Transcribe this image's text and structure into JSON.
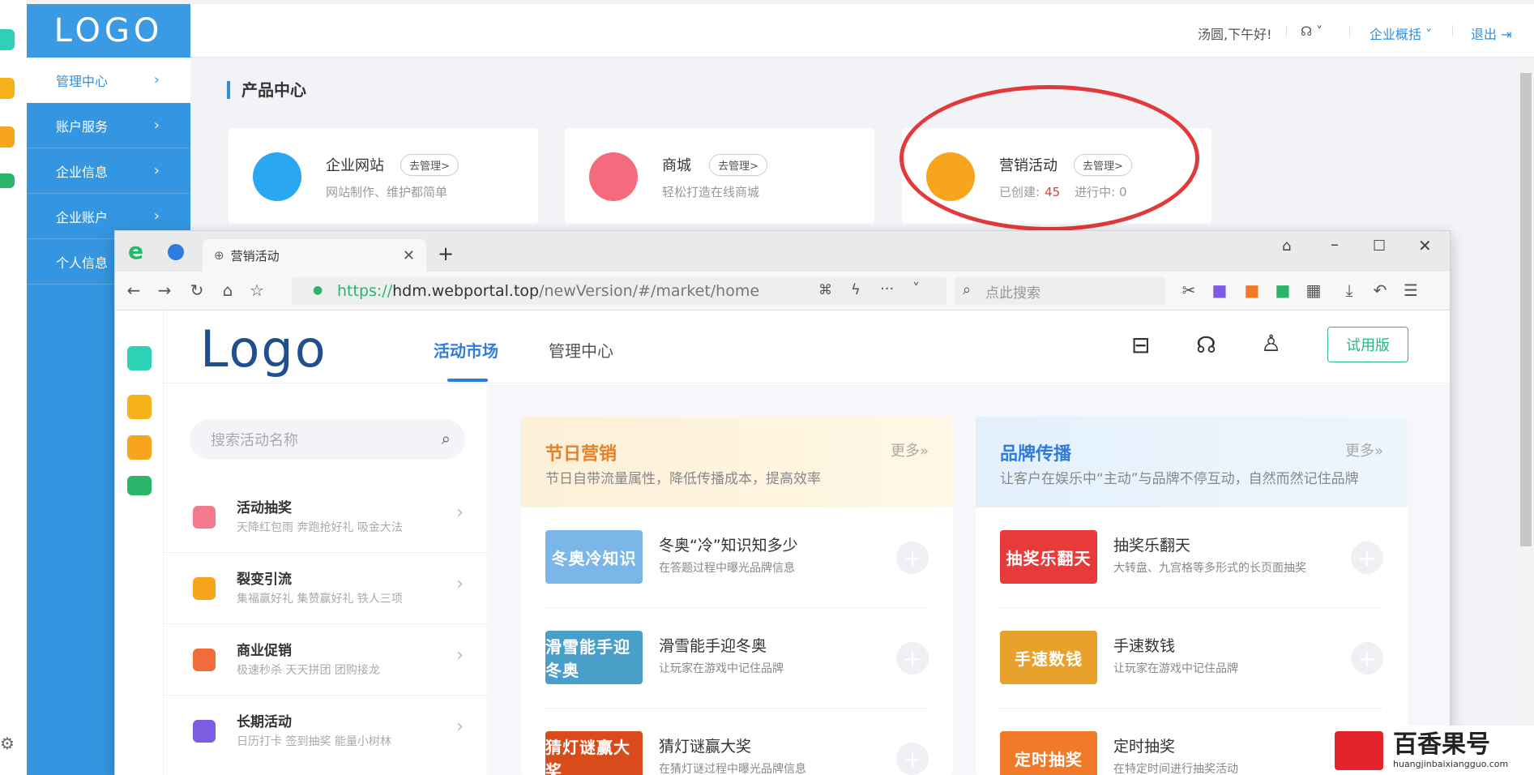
{
  "dock_left": [
    "plus-icon",
    "star-icon",
    "weibo-icon",
    "mail-icon",
    "settings-icon"
  ],
  "sidebar": {
    "logo": "LOGO",
    "items": [
      {
        "label": "管理中心",
        "active": true
      },
      {
        "label": "账户服务"
      },
      {
        "label": "企业信息"
      },
      {
        "label": "企业账户"
      },
      {
        "label": "个人信息"
      }
    ]
  },
  "header": {
    "greeting": "汤圆,下午好!",
    "enterprise": "企业概括",
    "logout": "退出"
  },
  "product_center": {
    "title": "产品中心",
    "cards": [
      {
        "name": "企业网站",
        "button": "去管理>",
        "desc": "网站制作、维护都简单",
        "color": "#2aa7f2"
      },
      {
        "name": "商城",
        "button": "去管理>",
        "desc": "轻松打造在线商城",
        "color": "#f36b7c"
      },
      {
        "name": "营销活动",
        "button": "去管理>",
        "created_label": "已创建:",
        "created": "45",
        "running_label": "进行中:",
        "running": "0",
        "color": "#f7a51d"
      }
    ]
  },
  "browser": {
    "tab_title": "营销活动",
    "url_scheme": "https://",
    "url_host": "hdm.webportal.top",
    "url_path": "/newVersion/#/market/home",
    "search_placeholder": "点此搜索"
  },
  "app": {
    "logo": "Logo",
    "nav": [
      "活动市场",
      "管理中心"
    ],
    "trial": "试用版",
    "search_placeholder": "搜索活动名称",
    "categories": [
      {
        "title": "活动抽奖",
        "sub": "天降红包雨   奔跑抢好礼   吸金大法",
        "color": "#f27a8a"
      },
      {
        "title": "裂变引流",
        "sub": "集福赢好礼   集赞赢好礼   铁人三项",
        "color": "#f7a51d"
      },
      {
        "title": "商业促销",
        "sub": "极速秒杀   天天拼团   团购接龙",
        "color": "#f26b3a"
      },
      {
        "title": "长期活动",
        "sub": "日历打卡   签到抽奖   能量小树林",
        "color": "#7c5ce0"
      }
    ],
    "sections": [
      {
        "title": "节日营销",
        "desc": "节日自带流量属性，降低传播成本，提高效率",
        "more": "更多»",
        "title_color": "#e5812a",
        "items": [
          {
            "name": "冬奥“冷”知识知多少",
            "desc": "在答题过程中曝光品牌信息",
            "thumb": "冬奥冷知识",
            "color": "#7ab7e8"
          },
          {
            "name": "滑雪能手迎冬奥",
            "desc": "让玩家在游戏中记住品牌",
            "thumb": "滑雪能手迎冬奥",
            "color": "#4a9fc9"
          },
          {
            "name": "猜灯谜赢大奖",
            "desc": "在猜灯谜过程中曝光品牌信息",
            "thumb": "猜灯谜赢大奖",
            "color": "#d84c1c"
          }
        ]
      },
      {
        "title": "品牌传播",
        "desc": "让客户在娱乐中“主动”与品牌不停互动，自然而然记住品牌",
        "more": "更多»",
        "title_color": "#2f7be0",
        "items": [
          {
            "name": "抽奖乐翻天",
            "desc": "大转盘、九宫格等多形式的长页面抽奖",
            "thumb": "抽奖乐翻天",
            "color": "#e83a3a"
          },
          {
            "name": "手速数钱",
            "desc": "让玩家在游戏中记住品牌",
            "thumb": "手速数钱",
            "color": "#e8a12a"
          },
          {
            "name": "定时抽奖",
            "desc": "在特定时间进行抽奖活动",
            "thumb": "定时抽奖",
            "color": "#f07a2a"
          }
        ]
      }
    ]
  },
  "watermark": {
    "brand": "百香果号",
    "url": "huangjinbaixiangguo.com"
  }
}
